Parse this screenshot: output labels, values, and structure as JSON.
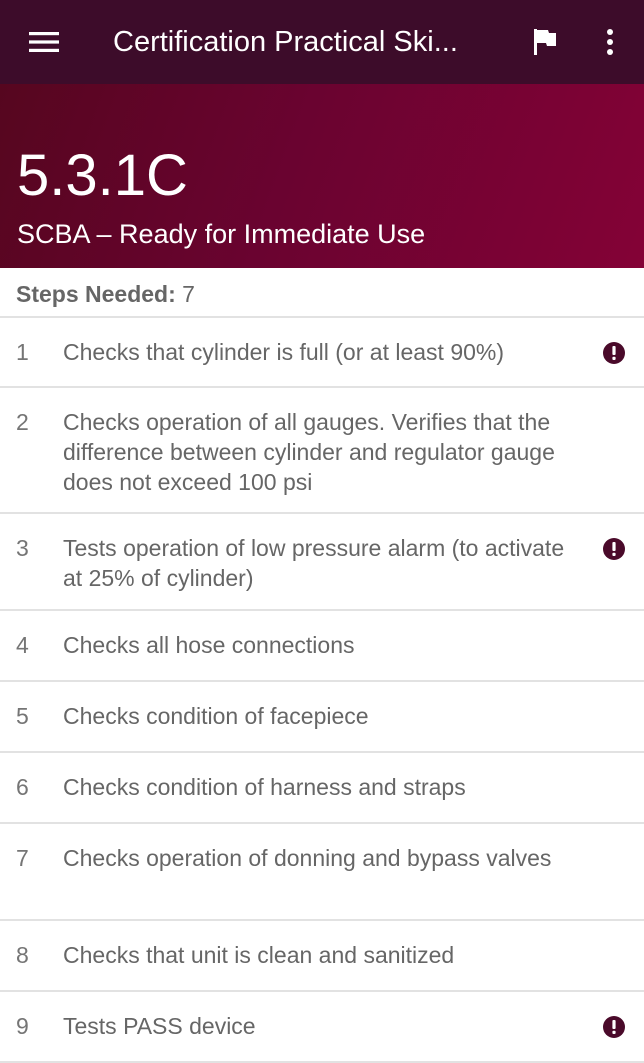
{
  "colors": {
    "appbar": "#3d0c2a",
    "hero_start": "#56061f",
    "hero_end": "#840236",
    "alert_icon": "#4a0a2a",
    "text_secondary": "#666666",
    "divider": "#e2e2e2"
  },
  "appbar": {
    "menu_icon": "hamburger-menu-icon",
    "title": "Certification Practical Ski...",
    "flag_icon": "flag-icon",
    "more_icon": "more-vertical-icon"
  },
  "hero": {
    "code": "5.3.1C",
    "subtitle": "SCBA – Ready for Immediate Use"
  },
  "steps_needed": {
    "label": "Steps Needed:",
    "value": "7"
  },
  "steps": [
    {
      "number": "1",
      "text": "Checks that cylinder is full (or at least 90%)",
      "alert": true
    },
    {
      "number": "2",
      "text": "Checks operation of all gauges. Verifies that the difference between cylinder and regulator gauge does not exceed 100 psi",
      "alert": false
    },
    {
      "number": "3",
      "text": "Tests operation of low pressure alarm (to activate at 25% of cylinder)",
      "alert": true
    },
    {
      "number": "4",
      "text": "Checks all hose connections",
      "alert": false
    },
    {
      "number": "5",
      "text": "Checks condition of facepiece",
      "alert": false
    },
    {
      "number": "6",
      "text": "Checks condition of harness and straps",
      "alert": false
    },
    {
      "number": "7",
      "text": "Checks operation of donning and bypass valves",
      "alert": false
    },
    {
      "number": "8",
      "text": "Checks that unit is clean and sanitized",
      "alert": false
    },
    {
      "number": "9",
      "text": "Tests PASS device",
      "alert": true
    }
  ],
  "alert_icon_name": "exclamation-circle-icon"
}
